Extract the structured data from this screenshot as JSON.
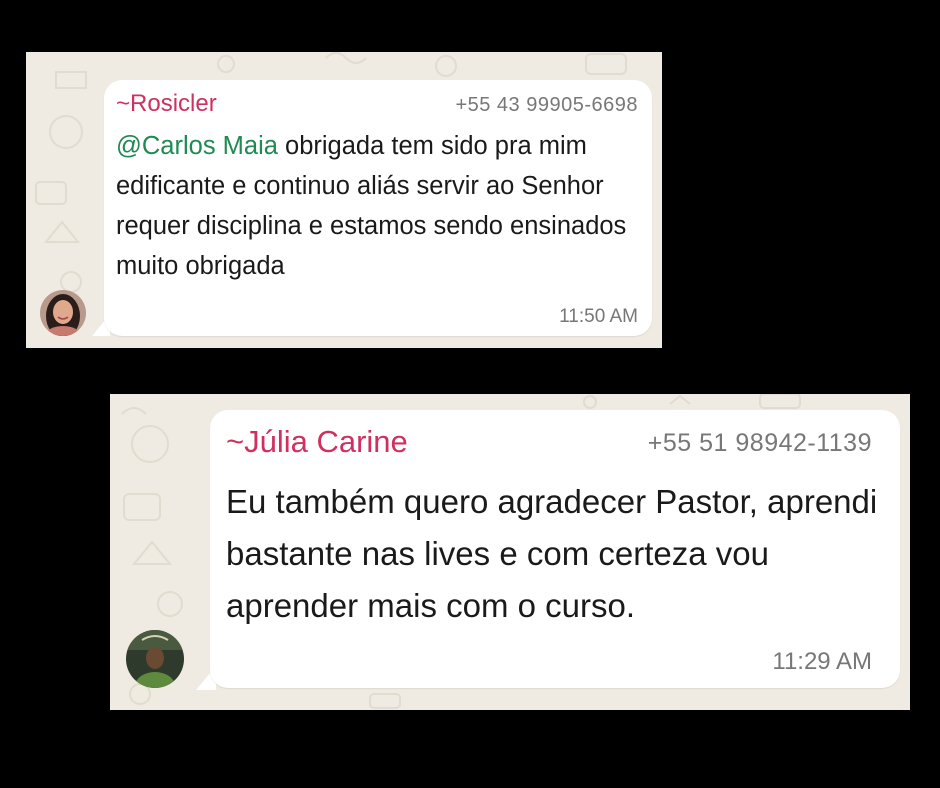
{
  "messages": [
    {
      "sender": "~Rosicler",
      "phone": "+55 43 99905-6698",
      "mention": "@Carlos Maia",
      "text": " obrigada tem sido pra mim edificante e continuo aliás servir ao Senhor requer disciplina e estamos sendo ensinados muito obrigada",
      "time": "11:50 AM",
      "avatar_icon": "user-avatar-woman"
    },
    {
      "sender": "~Júlia Carine",
      "phone": "+55 51 98942-1139",
      "text": "Eu também quero agradecer Pastor, aprendi bastante nas lives e com certeza vou aprender mais com o curso.",
      "time": "11:29 AM",
      "avatar_icon": "user-avatar-person"
    }
  ],
  "colors": {
    "page_background": "#000000",
    "chat_wallpaper": "#efeae2",
    "bubble": "#ffffff",
    "sender_name": "#d0305f",
    "mention": "#1f8a54",
    "meta_text": "#777777"
  }
}
